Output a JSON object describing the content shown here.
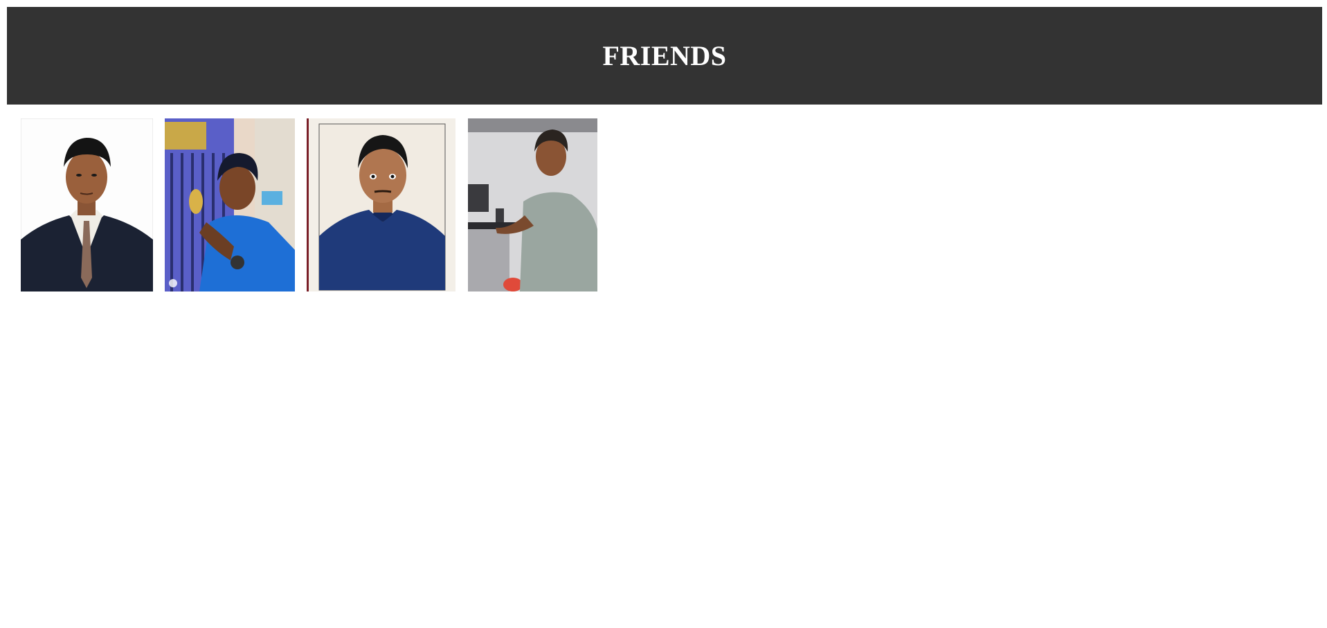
{
  "header": {
    "title": "FRIENDS",
    "background_color": "#333333",
    "text_color": "#ffffff"
  },
  "gallery": {
    "photos": [
      {
        "subject": "portrait-suit-white-background"
      },
      {
        "subject": "portrait-blue-shirt-gate-background"
      },
      {
        "subject": "passport-photo-navy-shirt"
      },
      {
        "subject": "standing-photo-grey-shirt-computer-lab"
      }
    ]
  }
}
